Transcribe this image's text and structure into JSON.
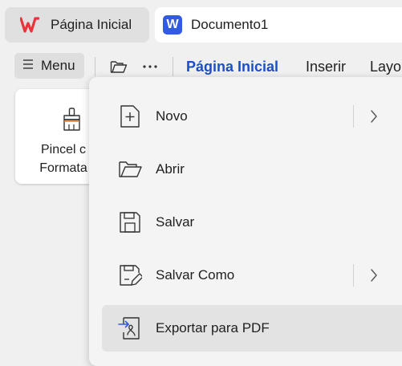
{
  "tabs": [
    {
      "label": "Página Inicial",
      "icon": "wps-logo-icon"
    },
    {
      "label": "Documento1",
      "icon": "word-document-icon",
      "icon_letter": "W"
    }
  ],
  "toolbar": {
    "menu_label": "Menu",
    "ribbon_tabs": [
      "Página Inicial",
      "Inserir",
      "Layo"
    ],
    "active_tab": "Página Inicial",
    "accent_color": "#1c4fc7"
  },
  "paint_format": {
    "line1": "Pincel c",
    "line2": "Formata"
  },
  "menu": {
    "items": [
      {
        "label": "Novo",
        "icon": "new-file-icon",
        "submenu": true
      },
      {
        "label": "Abrir",
        "icon": "open-folder-icon",
        "submenu": false
      },
      {
        "label": "Salvar",
        "icon": "save-icon",
        "submenu": false
      },
      {
        "label": "Salvar Como",
        "icon": "save-as-icon",
        "submenu": true
      },
      {
        "label": "Exportar para PDF",
        "icon": "export-pdf-icon",
        "submenu": false,
        "highlighted": true
      }
    ]
  }
}
